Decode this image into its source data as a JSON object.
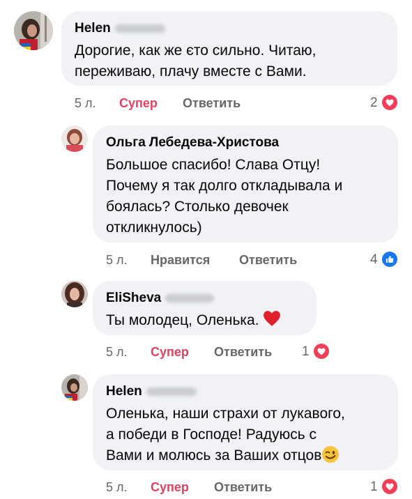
{
  "comments": [
    {
      "author": "Helen",
      "text_lines": [
        "Дорогие, как же єто сильно. Читаю,",
        "переживаю, плачу вместе с Вами."
      ],
      "time": "5 л.",
      "reaction_action": "Супер",
      "reply_label": "Ответить",
      "reaction_count": "2",
      "reaction_icon": "heart-icon"
    },
    {
      "author": "Ольга Лебедева-Христова",
      "text_lines": [
        "Большое спасибо! Слава Отцу!",
        "Почему я так долго откладывала и",
        "боялась? Столько девочек",
        "откликнулось)"
      ],
      "time": "5 л.",
      "reaction_action": "Нравится",
      "reply_label": "Ответить",
      "reaction_count": "4",
      "reaction_icon": "like-icon"
    },
    {
      "author": "EliSheva",
      "text_lines": [
        "Ты молодец, Оленька."
      ],
      "time": "5 л.",
      "reaction_action": "Супер",
      "reply_label": "Ответить",
      "reaction_count": "1",
      "reaction_icon": "heart-icon"
    },
    {
      "author": "Helen",
      "text_lines": [
        "Оленька, наши страхи от лукавого,",
        "а победи в Господе! Радуюсь с",
        "Вами и молюсь за Ваших отцов"
      ],
      "time": "5 л.",
      "reaction_action": "Супер",
      "reply_label": "Ответить",
      "reaction_count": "1",
      "reaction_icon": "heart-icon"
    }
  ],
  "colors": {
    "bubble": "#f0f2f5",
    "meta_text": "#65676b",
    "super_active": "#e4405f",
    "heart": "#f33e58",
    "like": "#1877f2"
  }
}
